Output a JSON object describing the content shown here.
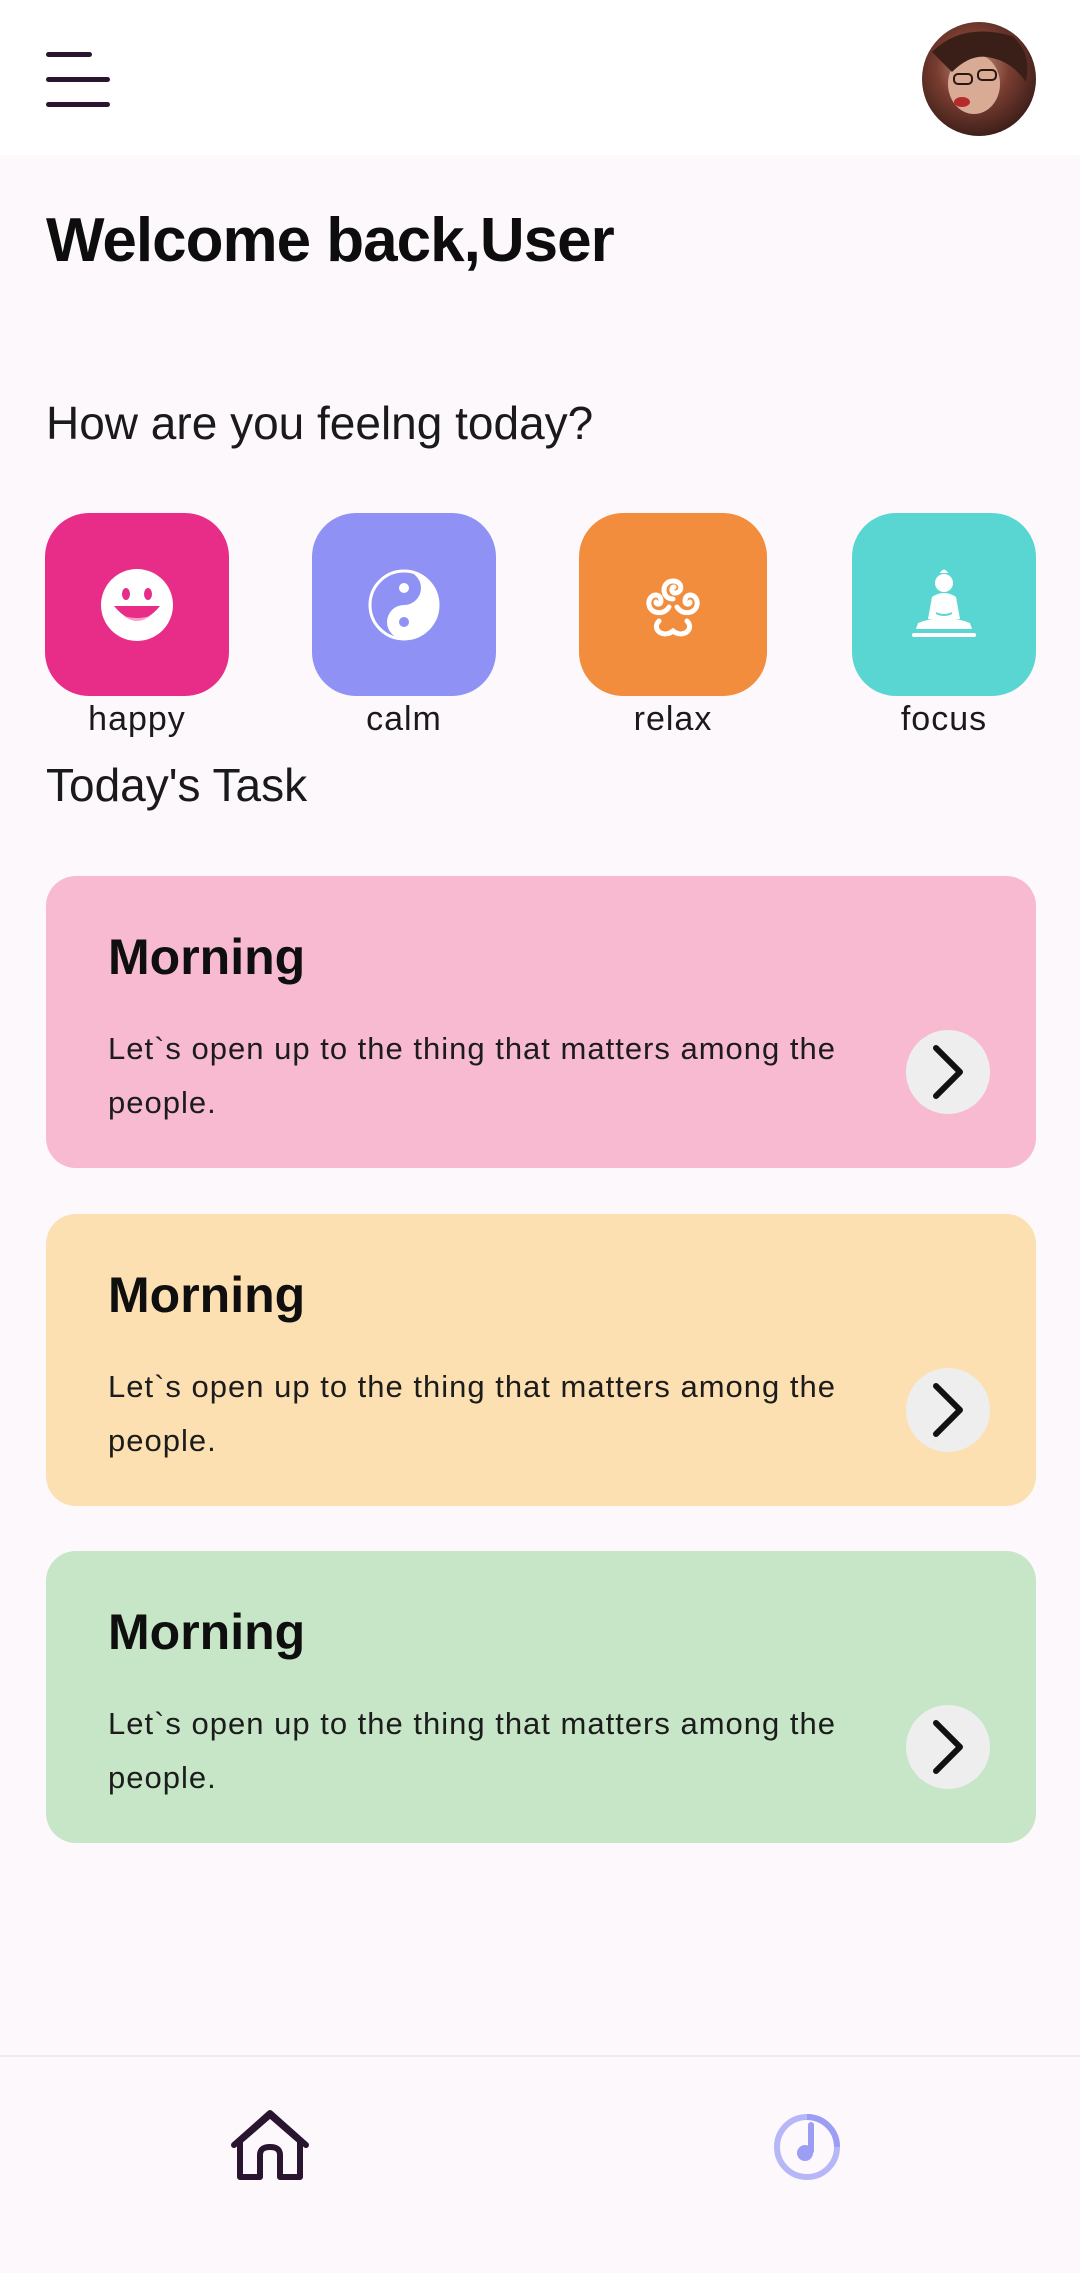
{
  "header": {
    "menu_icon": "hamburger-menu-icon",
    "avatar": "user-avatar"
  },
  "greeting": {
    "title": "Welcome back,User",
    "question": "How are you feelng today?"
  },
  "moods": [
    {
      "label": "happy",
      "icon": "smiley-face-icon",
      "color": "#e82d88"
    },
    {
      "label": "calm",
      "icon": "yin-yang-icon",
      "color": "#8f91f5"
    },
    {
      "label": "relax",
      "icon": "triskelion-spiral-icon",
      "color": "#f18d3d"
    },
    {
      "label": "focus",
      "icon": "meditating-buddha-icon",
      "color": "#5ad6d2"
    }
  ],
  "tasks": {
    "title": "Today's Task",
    "items": [
      {
        "title": "Morning",
        "description": "Let`s open up to the thing that matters among the people.",
        "color": "#f7bad0"
      },
      {
        "title": "Morning",
        "description": "Let`s open up to the thing that matters among the people.",
        "color": "#fde0b2"
      },
      {
        "title": "Morning",
        "description": "Let`s open up to the thing that matters among the people.",
        "color": "#c6e6c7"
      }
    ]
  },
  "bottom_nav": {
    "items": [
      {
        "icon": "home-icon",
        "active": true
      },
      {
        "icon": "music-timer-icon",
        "active": false
      }
    ]
  }
}
